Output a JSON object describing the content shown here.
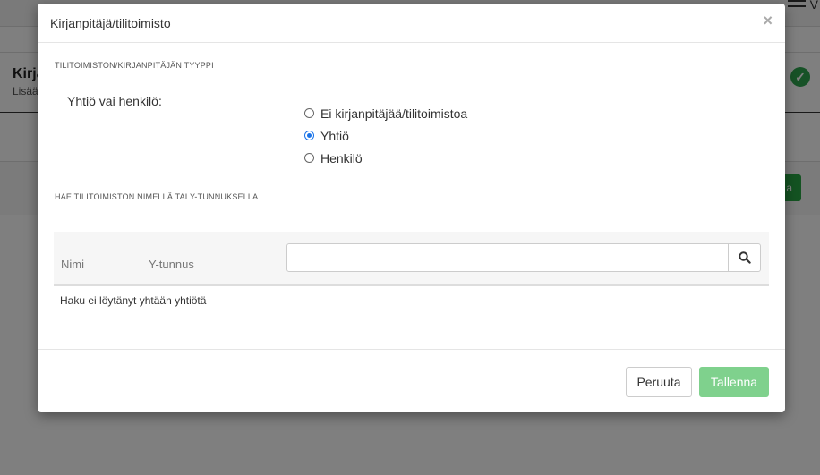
{
  "background": {
    "menu_text": "V",
    "page_title": "Kirja",
    "page_subtitle": "Lisää",
    "green_button_text": "a"
  },
  "modal": {
    "title": "Kirjanpitäjä/tilitoimisto",
    "close_glyph": "×",
    "type_section_label": "TILITOIMISTON/KIRJANPITÄJÄN TYYPPI",
    "company_or_person_label": "Yhtiö vai henkilö:",
    "radio_options": [
      {
        "label": "Ei kirjanpitäjää/tilitoimistoa",
        "checked": false
      },
      {
        "label": "Yhtiö",
        "checked": true
      },
      {
        "label": "Henkilö",
        "checked": false
      }
    ],
    "search_section_label": "HAE TILITOIMISTON NIMELLÄ TAI Y-TUNNUKSELLA",
    "search": {
      "value": "",
      "placeholder": "",
      "icon": "search-icon"
    },
    "columns": [
      "Nimi",
      "Y-tunnus"
    ],
    "empty_message": "Haku ei löytänyt yhtään yhtiötä",
    "cancel_label": "Peruuta",
    "save_label": "Tallenna"
  },
  "colors": {
    "accent_radio": "#1a73e8",
    "save_button": "#7fd18d",
    "status_check": "#2ea44f"
  }
}
